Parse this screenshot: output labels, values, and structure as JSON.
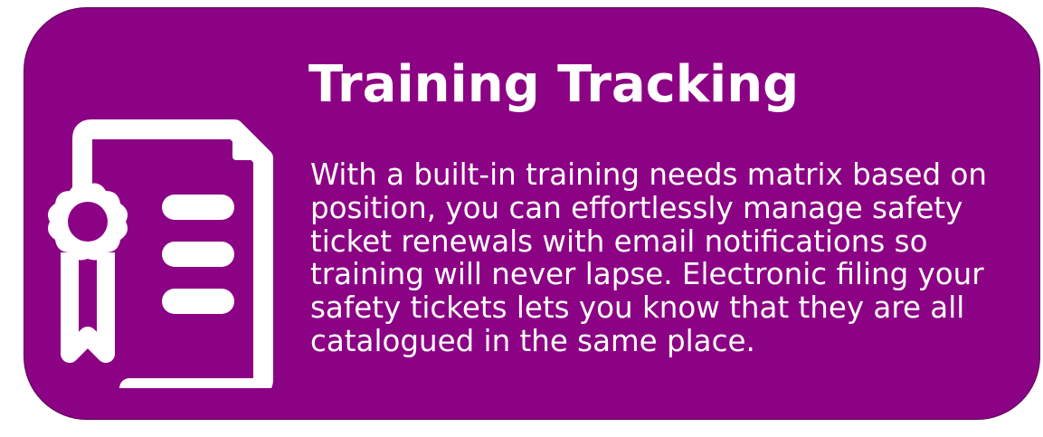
{
  "card": {
    "background_color": "#8c0284",
    "text_color": "#ffffff",
    "icon": "certificate-document-icon",
    "title": "Training Tracking",
    "description": "With a built-in training needs matrix based on position, you can effortlessly manage safety ticket renewals with email notifications so training will never lapse. Electronic filing your safety tickets lets you know that they are all catalogued in the same place."
  }
}
